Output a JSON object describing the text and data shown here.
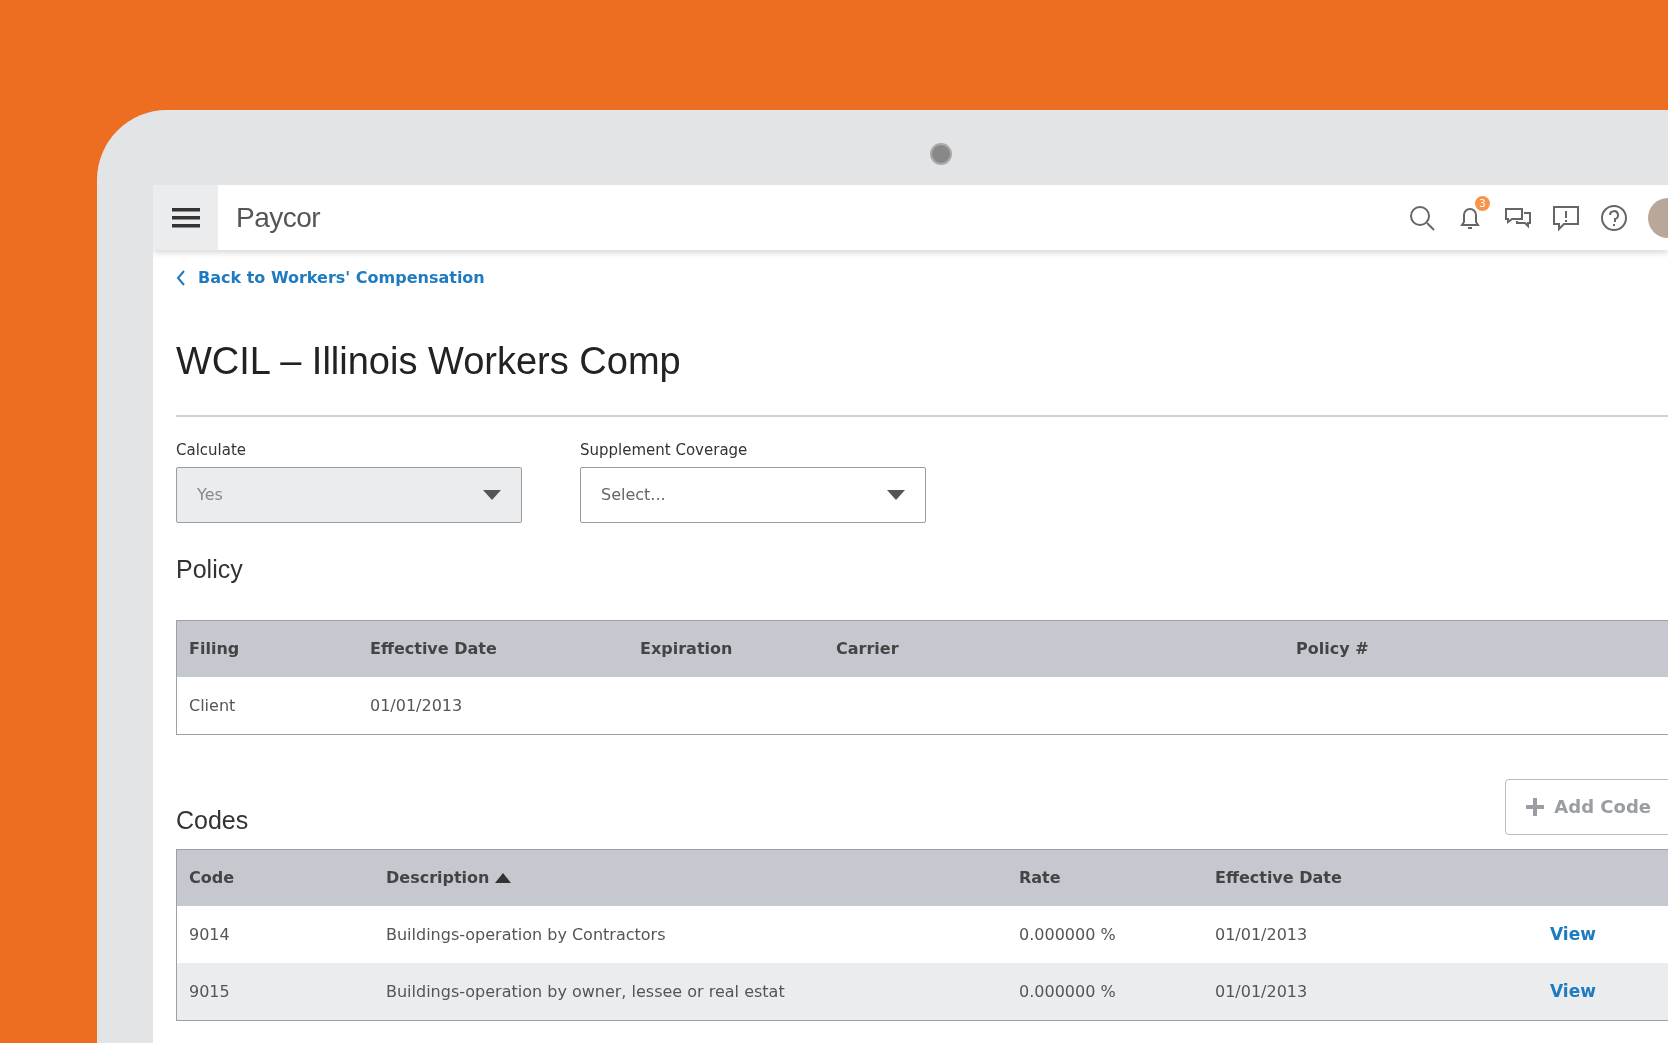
{
  "header": {
    "logo": "Paycor",
    "notification_count": "3"
  },
  "back_link": "Back to Workers' Compensation",
  "title": "WCIL – Illinois Workers Comp",
  "fields": [
    {
      "label": "Calculate",
      "value": "Yes",
      "disabled": true
    },
    {
      "label": "Supplement Coverage",
      "placeholder": "Select...",
      "disabled": false
    }
  ],
  "policy": {
    "heading": "Policy",
    "columns": [
      "Filing",
      "Effective Date",
      "Expiration",
      "Carrier",
      "Policy #"
    ],
    "rows": [
      [
        "Client",
        "01/01/2013",
        "",
        "",
        ""
      ]
    ]
  },
  "codes": {
    "heading": "Codes",
    "add_button": "Add Code",
    "columns": [
      {
        "label": "Code",
        "sorted": false
      },
      {
        "label": "Description",
        "sorted": true
      },
      {
        "label": "Rate",
        "sorted": false
      },
      {
        "label": "Effective Date",
        "sorted": false
      }
    ],
    "rows": [
      {
        "cells": [
          "9014",
          "Buildings-operation by Contractors",
          "0.000000 %",
          "01/01/2013"
        ],
        "action": "View"
      },
      {
        "cells": [
          "9015",
          "Buildings-operation by owner, lessee or real estat",
          "0.000000 %",
          "01/01/2013"
        ],
        "action": "View"
      }
    ]
  }
}
